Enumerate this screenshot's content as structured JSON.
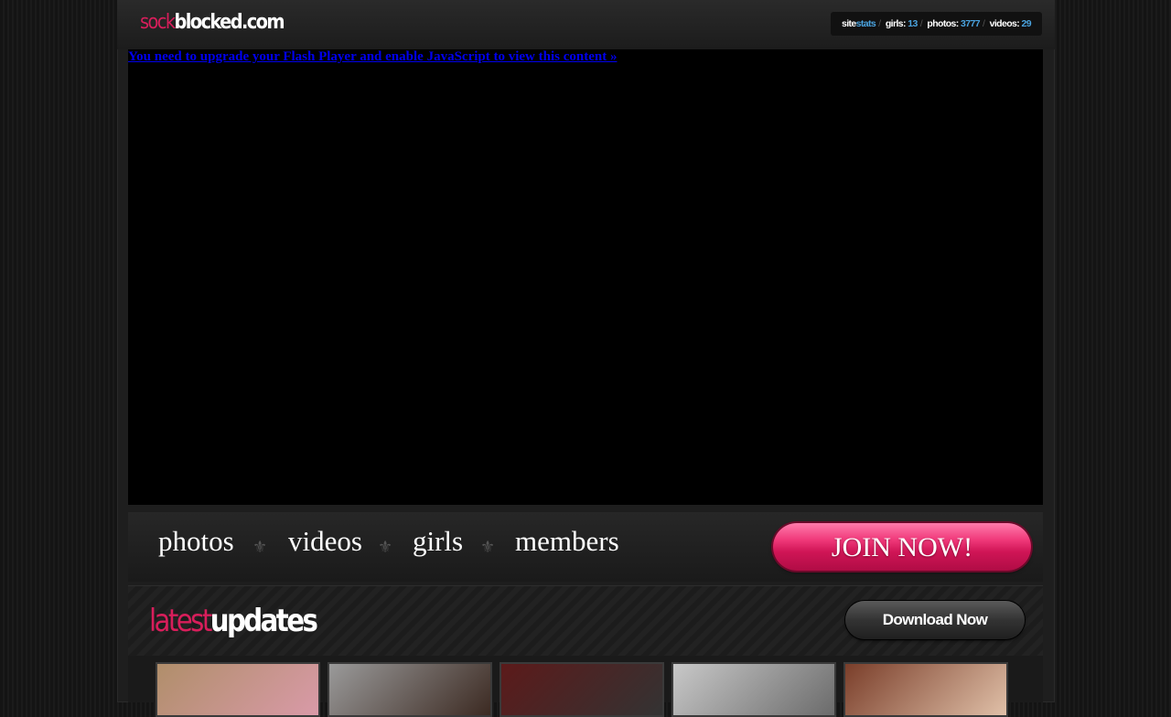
{
  "header": {
    "logo": {
      "part1": "sock",
      "part2": "blocked.com"
    },
    "stats": {
      "label_site": "site",
      "label_stats": "stats",
      "girls_label": "girls:",
      "girls_value": "13",
      "photos_label": "photos:",
      "photos_value": "3777",
      "videos_label": "videos:",
      "videos_value": "29"
    }
  },
  "player": {
    "flash_message": "You need to upgrade your Flash Player and enable JavaScript to view this content »"
  },
  "nav": {
    "items": [
      {
        "label": "photos"
      },
      {
        "label": "videos"
      },
      {
        "label": "girls"
      },
      {
        "label": "members"
      }
    ],
    "separator": "⚜",
    "join_label": "JOIN NOW!"
  },
  "updates": {
    "title_part1": "latest",
    "title_part2": "updates",
    "download_label": "Download Now",
    "thumbnails": [
      {
        "colors": [
          "#b08e6a",
          "#d99aa8"
        ]
      },
      {
        "colors": [
          "#9a9a9a",
          "#3c2a22"
        ]
      },
      {
        "colors": [
          "#5c1a1a",
          "#333"
        ]
      },
      {
        "colors": [
          "#c8c8c8",
          "#6b6b6b"
        ]
      },
      {
        "colors": [
          "#7a3e2a",
          "#e0c0a8"
        ]
      }
    ]
  },
  "colors": {
    "accent_pink": "#d81e5b",
    "stat_blue": "#4aa3df",
    "link_blue": "#0000ee"
  }
}
